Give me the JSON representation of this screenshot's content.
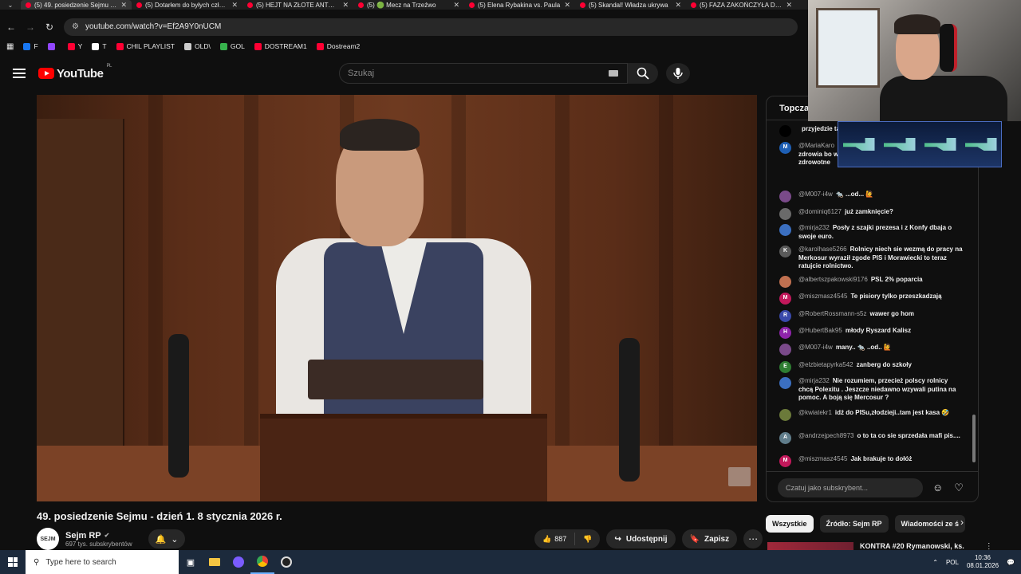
{
  "browser": {
    "tabs": [
      {
        "title": "(5) 49. posiedzenie Sejmu - dzień 1",
        "active": true
      },
      {
        "title": "(5) Dotarłem do byłych członków"
      },
      {
        "title": "(5) HEJT NA ZŁOTE ANTONÓWKI"
      },
      {
        "title": "(5) 🟢 Mecz na Trzeźwo"
      },
      {
        "title": "(5) Elena Rybakina vs. Paula"
      },
      {
        "title": "(5) Skandal! Władza ukrywa"
      },
      {
        "title": "(5) FAZA ZAKOŃCZYŁA DZIAŁANIE"
      }
    ],
    "url": "youtube.com/watch?v=Ef2A9Y0nUCM",
    "bookmarks": [
      {
        "label": "F",
        "color": "#1877f2"
      },
      {
        "label": "",
        "color": "#9146ff"
      },
      {
        "label": "Y",
        "color": "#ff0033"
      },
      {
        "label": "T",
        "color": "#ffffff"
      },
      {
        "label": "CHIL PLAYLIST",
        "color": "#ff0033"
      },
      {
        "label": "OLD\\",
        "color": "#cccccc"
      },
      {
        "label": "GOL",
        "color": "#37b24d"
      },
      {
        "label": "DOSTREAM1",
        "color": "#ff0033"
      },
      {
        "label": "Dostream2",
        "color": "#ff0033"
      }
    ]
  },
  "youtube": {
    "logo": "YouTube",
    "region": "PL",
    "search_placeholder": "Szukaj"
  },
  "video": {
    "title": "49. posiedzenie Sejmu - dzień 1. 8 stycznia 2026 r.",
    "channel_name": "Sejm RP",
    "channel_avatar_text": "SEJM",
    "subscribers": "697 tys. subskrybentów",
    "likes": "887",
    "share_label": "Udostępnij",
    "save_label": "Zapisz"
  },
  "chat": {
    "header": "Topczat",
    "input_placeholder": "Czatuj jako subskrybent...",
    "messages": [
      {
        "user": "",
        "text": "przyjedzie ta",
        "avatar": "",
        "color": "#000000"
      },
      {
        "user": "@MariaKaro",
        "text": "rolników prze... przeniosą b... służbę zdrowia bo w tej chwili płacą najniższe składki zdrowotne",
        "avatar": "M",
        "color": "#1e5fb4"
      },
      {
        "user": "@M007-i4w",
        "text": "🐀 ...od... 🙋",
        "avatar": "",
        "color": "#7a4a8a"
      },
      {
        "user": "@dominiq6127",
        "text": "już zamknięcie?",
        "avatar": "",
        "color": "#6a6a6a"
      },
      {
        "user": "@mirja232",
        "text": "Posły z szajki prezesa i z Konfy dbaja o swoje euro.",
        "avatar": "",
        "color": "#3b6fc0"
      },
      {
        "user": "@karolhase5266",
        "text": "Rolnicy niech sie wezmą do pracy na Merkosur wyraził zgode PIS i Morawiecki to teraz ratujcie rolnictwo.",
        "avatar": "K",
        "color": "#5a5a5a"
      },
      {
        "user": "@albertszpakowski9176",
        "text": "PSL 2% poparcia",
        "avatar": "",
        "color": "#c07050"
      },
      {
        "user": "@miszmasz4545",
        "text": "Te pisiory tylko przeszkadzają",
        "avatar": "M",
        "color": "#c2185b"
      },
      {
        "user": "@RobertRossmann-s5z",
        "text": "wawer go hom",
        "avatar": "R",
        "color": "#3949ab"
      },
      {
        "user": "@HubertBak95",
        "text": "młody Ryszard Kalisz",
        "avatar": "H",
        "color": "#8e24aa"
      },
      {
        "user": "@M007-i4w",
        "text": "many.. 🐀 ..od.. 🙋",
        "avatar": "",
        "color": "#7a4a8a"
      },
      {
        "user": "@elzbietapyrka542",
        "text": "zanberg do szkoły",
        "avatar": "E",
        "color": "#2e7d32"
      },
      {
        "user": "@mirja232",
        "text": "Nie rozumiem, przecież polscy rolnicy chcą Polexitu . Jeszcze niedawno wzywali putina na pomoc. A boją się Mercosur ?",
        "avatar": "",
        "color": "#3b6fc0"
      },
      {
        "user": "@kwiatekr1",
        "text": "idź do PISu,złodzieji..tam jest kasa 🤣",
        "avatar": "",
        "color": "#6b7a3a"
      },
      {
        "user": "@andrzejpech8973",
        "text": "o to ta co sie sprzedała mafi pis....",
        "avatar": "A",
        "color": "#607d8b"
      },
      {
        "user": "@miszmasz4545",
        "text": "Jak brakuje to dołóż",
        "avatar": "M",
        "color": "#c2185b"
      }
    ]
  },
  "sidebar": {
    "chips": [
      "Wszystkie",
      "Źródło: Sejm RP",
      "Wiadomości ze ś"
    ],
    "recommended_title": "KONTRA #20 Rymanowski, ks."
  },
  "taskbar": {
    "search_placeholder": "Type here to search",
    "language": "POL",
    "time": "10:36",
    "date": "08.01.2026"
  }
}
